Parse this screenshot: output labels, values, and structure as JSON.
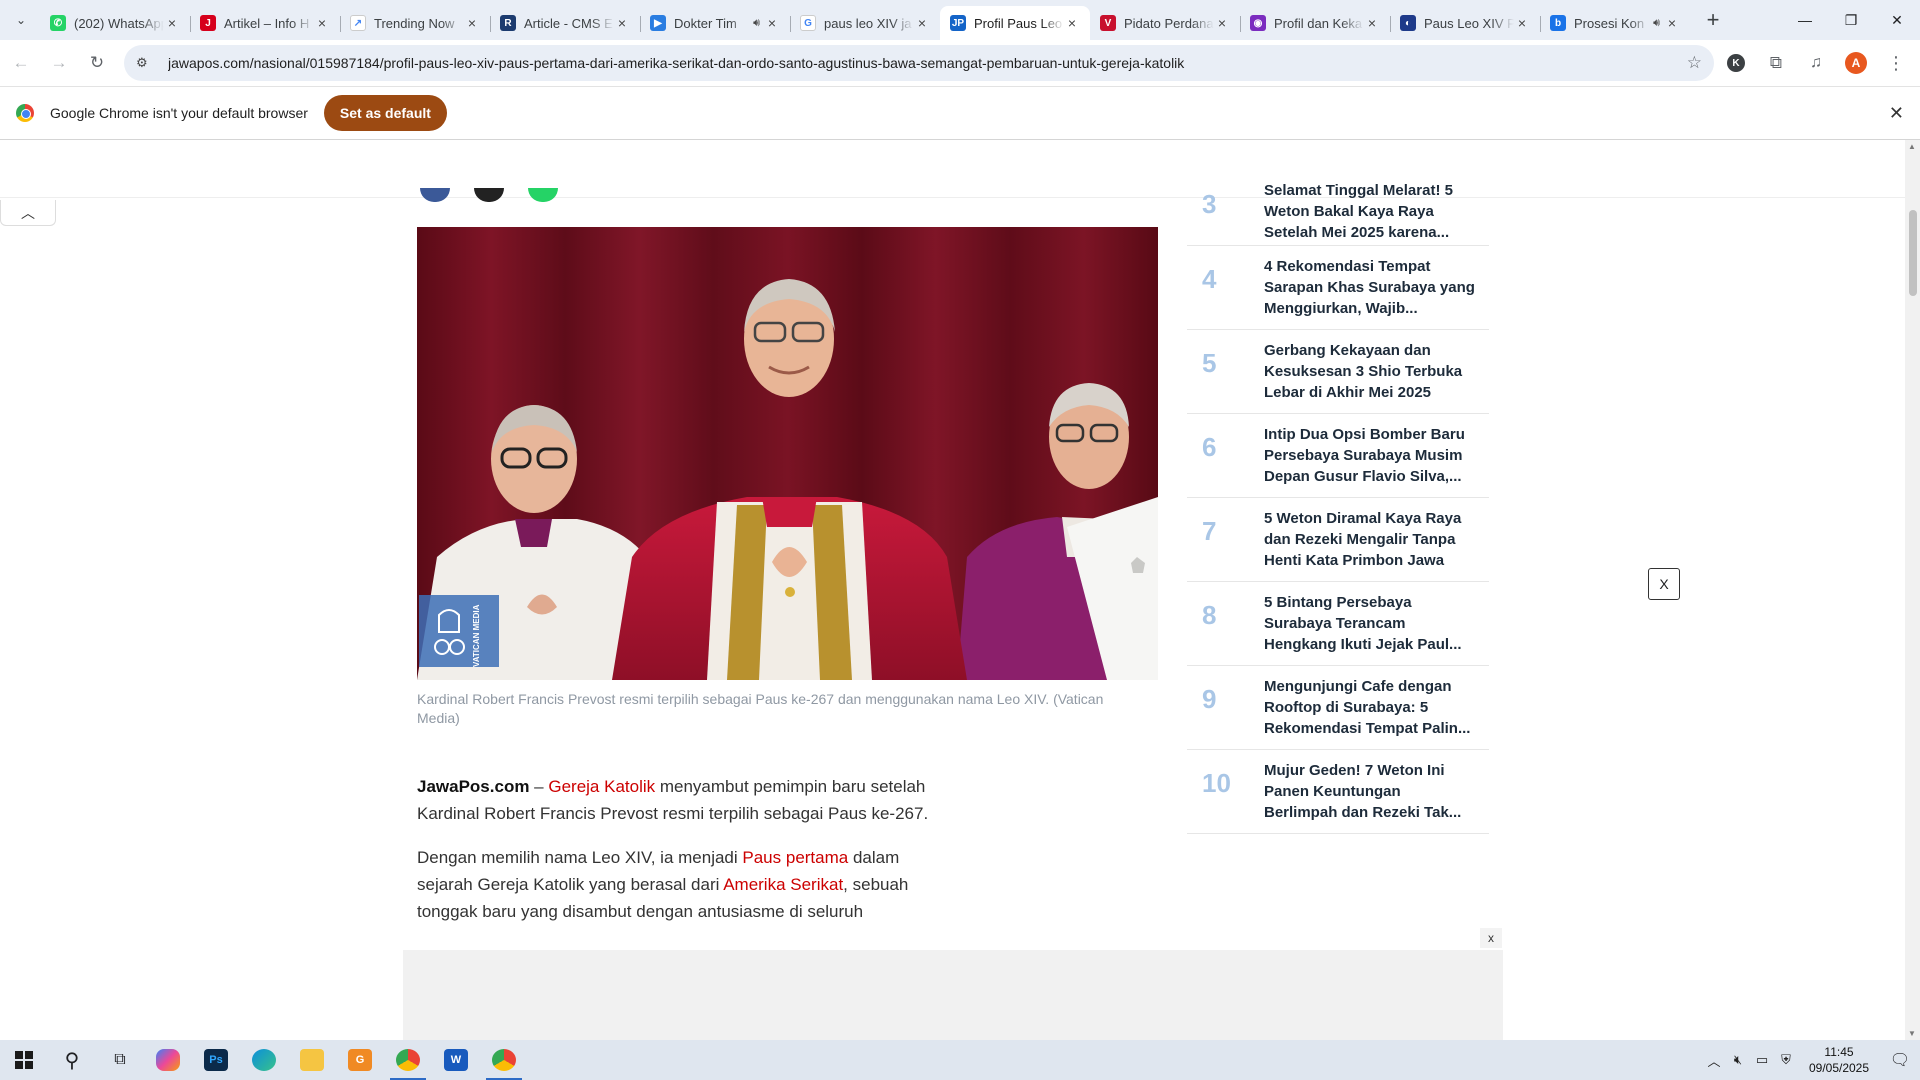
{
  "browser": {
    "tabs": [
      {
        "title": "(202) WhatsApp",
        "favicon_color": "#25d366",
        "favicon_glyph": "✆",
        "audio": false
      },
      {
        "title": "Artikel – Info H",
        "favicon_color": "#d6001c",
        "favicon_glyph": "J",
        "audio": false
      },
      {
        "title": "Trending Now",
        "favicon_color": "#ffffff",
        "favicon_glyph": "↗",
        "audio": false
      },
      {
        "title": "Article - CMS E",
        "favicon_color": "#1c3b6f",
        "favicon_glyph": "R",
        "audio": false
      },
      {
        "title": "Dokter Tim",
        "favicon_color": "#2a7de1",
        "favicon_glyph": "▶",
        "audio": true
      },
      {
        "title": "paus leo XIV ja",
        "favicon_color": "#ffffff",
        "favicon_glyph": "G",
        "audio": false
      },
      {
        "title": "Profil Paus Leo",
        "favicon_color": "#1464c8",
        "favicon_glyph": "JP",
        "audio": false,
        "active": true
      },
      {
        "title": "Pidato Perdana",
        "favicon_color": "#c8102e",
        "favicon_glyph": "V",
        "audio": false
      },
      {
        "title": "Profil dan Keka",
        "favicon_color": "#7b2cbf",
        "favicon_glyph": "◉",
        "audio": false
      },
      {
        "title": "Paus Leo XIV P",
        "favicon_color": "#1e3a8a",
        "favicon_glyph": "◐",
        "audio": false
      },
      {
        "title": "Prosesi Kon",
        "favicon_color": "#1a73e8",
        "favicon_glyph": "b",
        "audio": true
      }
    ],
    "url": "jawapos.com/nasional/015987184/profil-paus-leo-xiv-paus-pertama-dari-amerika-serikat-dan-ordo-santo-agustinus-bawa-semangat-pembaruan-untuk-gereja-katolik",
    "profile_k": "K",
    "profile_a": "A"
  },
  "infobar": {
    "message": "Google Chrome isn't your default browser",
    "button": "Set as default"
  },
  "article": {
    "image_watermark": "VATICAN MEDIA",
    "caption": "Kardinal Robert Francis Prevost resmi terpilih sebagai Paus ke-267 dan menggunakan nama Leo XIV. (Vatican Media)",
    "p1": {
      "brand": "JawaPos.com",
      "dash": " – ",
      "link1": "Gereja Katolik",
      "text1": " menyambut pemimpin baru setelah Kardinal Robert Francis Prevost resmi terpilih sebagai Paus ke-267."
    },
    "p2": {
      "text0": "Dengan memilih nama Leo XIV, ia menjadi ",
      "link1": "Paus pertama",
      "text1": " dalam sejarah Gereja Katolik yang berasal dari ",
      "link2": "Amerika Serikat",
      "text2": ", sebuah tonggak baru yang disambut dengan antusiasme di seluruh"
    }
  },
  "sidebar": {
    "items": [
      {
        "rank": "3",
        "title": "Selamat Tinggal Melarat! 5 Weton Bakal Kaya Raya Setelah Mei 2025 karena..."
      },
      {
        "rank": "4",
        "title": "4 Rekomendasi Tempat Sarapan Khas Surabaya yang Menggiurkan, Wajib..."
      },
      {
        "rank": "5",
        "title": "Gerbang Kekayaan dan Kesuksesan 3 Shio Terbuka Lebar di Akhir Mei 2025"
      },
      {
        "rank": "6",
        "title": "Intip Dua Opsi Bomber Baru Persebaya Surabaya Musim Depan Gusur Flavio Silva,..."
      },
      {
        "rank": "7",
        "title": "5 Weton Diramal Kaya Raya dan Rezeki Mengalir Tanpa Henti Kata Primbon Jawa"
      },
      {
        "rank": "8",
        "title": "5 Bintang Persebaya Surabaya Terancam Hengkang Ikuti Jejak Paul..."
      },
      {
        "rank": "9",
        "title": "Mengunjungi Cafe dengan Rooftop di Surabaya: 5 Rekomendasi Tempat Palin..."
      },
      {
        "rank": "10",
        "title": "Mujur Geden! 7 Weton Ini Panen Keuntungan Berlimpah dan Rezeki Tak..."
      }
    ]
  },
  "overlays": {
    "float_close": "X",
    "ad_close": "x"
  },
  "taskbar": {
    "time": "11:45",
    "date": "09/05/2025"
  }
}
